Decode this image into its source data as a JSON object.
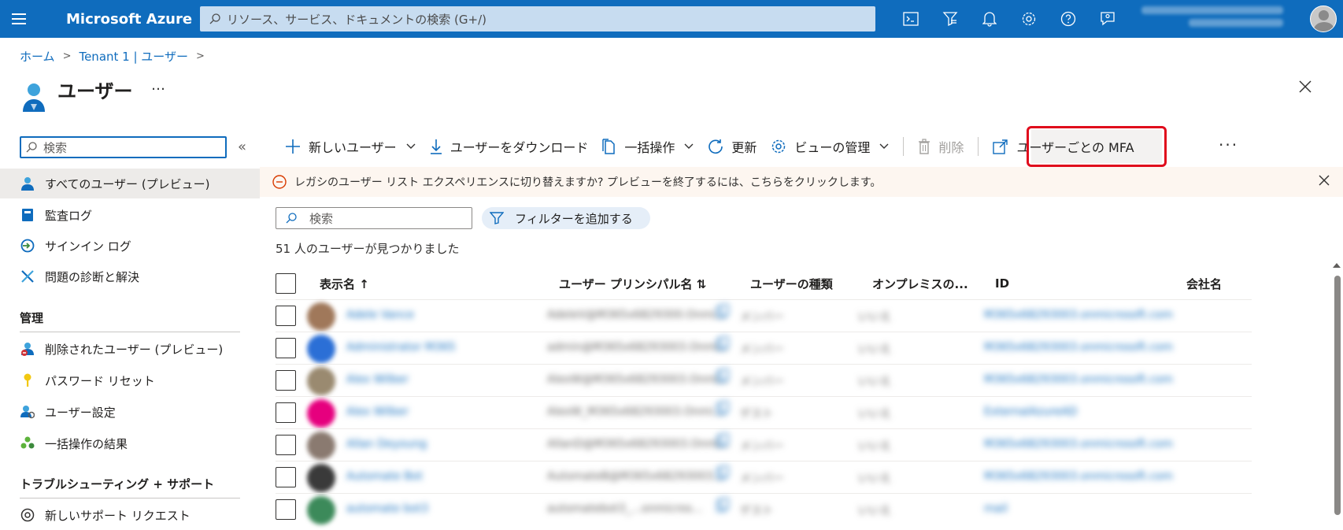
{
  "topbar": {
    "brand": "Microsoft Azure",
    "search_placeholder": "リソース、サービス、ドキュメントの検索 (G+/)",
    "icons": [
      "cloud-shell-icon",
      "directory-filter-icon",
      "notifications-icon",
      "settings-icon",
      "help-icon",
      "feedback-icon"
    ]
  },
  "breadcrumb": {
    "home": "ホーム",
    "tenant": "Tenant 1 | ユーザー"
  },
  "page": {
    "title": "ユーザー",
    "more": "…"
  },
  "sidebar": {
    "search_placeholder": "検索",
    "collapse": "«",
    "items": [
      {
        "label": "すべてのユーザー (プレビュー)",
        "icon": "user-icon",
        "active": true
      },
      {
        "label": "監査ログ",
        "icon": "book-icon"
      },
      {
        "label": "サインイン ログ",
        "icon": "signin-icon"
      },
      {
        "label": "問題の診断と解決",
        "icon": "tools-icon"
      }
    ],
    "section_manage": "管理",
    "manage_items": [
      {
        "label": "削除されたユーザー (プレビュー)",
        "icon": "deleted-user-icon"
      },
      {
        "label": "パスワード リセット",
        "icon": "key-icon"
      },
      {
        "label": "ユーザー設定",
        "icon": "user-settings-icon"
      },
      {
        "label": "一括操作の結果",
        "icon": "bulk-results-icon"
      }
    ],
    "section_troubleshoot": "トラブルシューティング + サポート",
    "troubleshoot_items": [
      {
        "label": "新しいサポート リクエスト",
        "icon": "support-icon"
      }
    ]
  },
  "toolbar": {
    "new_user": "新しいユーザー",
    "download": "ユーザーをダウンロード",
    "bulk": "一括操作",
    "refresh": "更新",
    "manage_view": "ビューの管理",
    "delete": "削除",
    "per_user_mfa": "ユーザーごとの MFA",
    "more": "···"
  },
  "banner": {
    "text": "レガシのユーザー リスト エクスペリエンスに切り替えますか? プレビューを終了するには、こちらをクリックします。"
  },
  "list": {
    "search_placeholder": "検索",
    "add_filter": "フィルターを追加する",
    "count_text": "51 人のユーザーが見つかりました",
    "columns": [
      "表示名 ↑",
      "ユーザー プリンシパル名 ⇅",
      "ユーザーの種類",
      "オンプレミスの...",
      "ID",
      "会社名"
    ],
    "rows": [
      {
        "name": "Adele Vance",
        "upn": "AdeleV@M365x6829300.Onmi...",
        "type": "メンバー",
        "onprem": "いいえ",
        "id": "M365x68293003.onmicrosoft.com",
        "avatar": "#a0785a"
      },
      {
        "name": "Administrator M365",
        "upn": "admin@M365x68293003.Onmi...",
        "type": "メンバー",
        "onprem": "いいえ",
        "id": "M365x68293003.onmicrosoft.com",
        "avatar": "#2b6fd6"
      },
      {
        "name": "Alex Wilber",
        "upn": "AlexW@M365x68293003.Onmi...",
        "type": "メンバー",
        "onprem": "いいえ",
        "id": "M365x68293003.onmicrosoft.com",
        "avatar": "#9a8a70"
      },
      {
        "name": "Alex Wilber",
        "upn": "AlexW_M365x68293003.Onmi...",
        "type": "ゲスト",
        "onprem": "いいえ",
        "id": "ExternalAzureAD",
        "avatar": "#e6007e"
      },
      {
        "name": "Allan Deyoung",
        "upn": "AllanD@M365x68293003.Onmi...",
        "type": "メンバー",
        "onprem": "いいえ",
        "id": "M365x68293003.onmicrosoft.com",
        "avatar": "#8a7a70"
      },
      {
        "name": "Automate Bot",
        "upn": "AutomateB@M365x68293003...",
        "type": "メンバー",
        "onprem": "いいえ",
        "id": "M365x68293003.onmicrosoft.com",
        "avatar": "#3a3a3a"
      },
      {
        "name": "automate bot3",
        "upn": "automatebot3_...onmicros...",
        "type": "ゲスト",
        "onprem": "いいえ",
        "id": "mail",
        "avatar": "#3c8a5a"
      }
    ]
  }
}
